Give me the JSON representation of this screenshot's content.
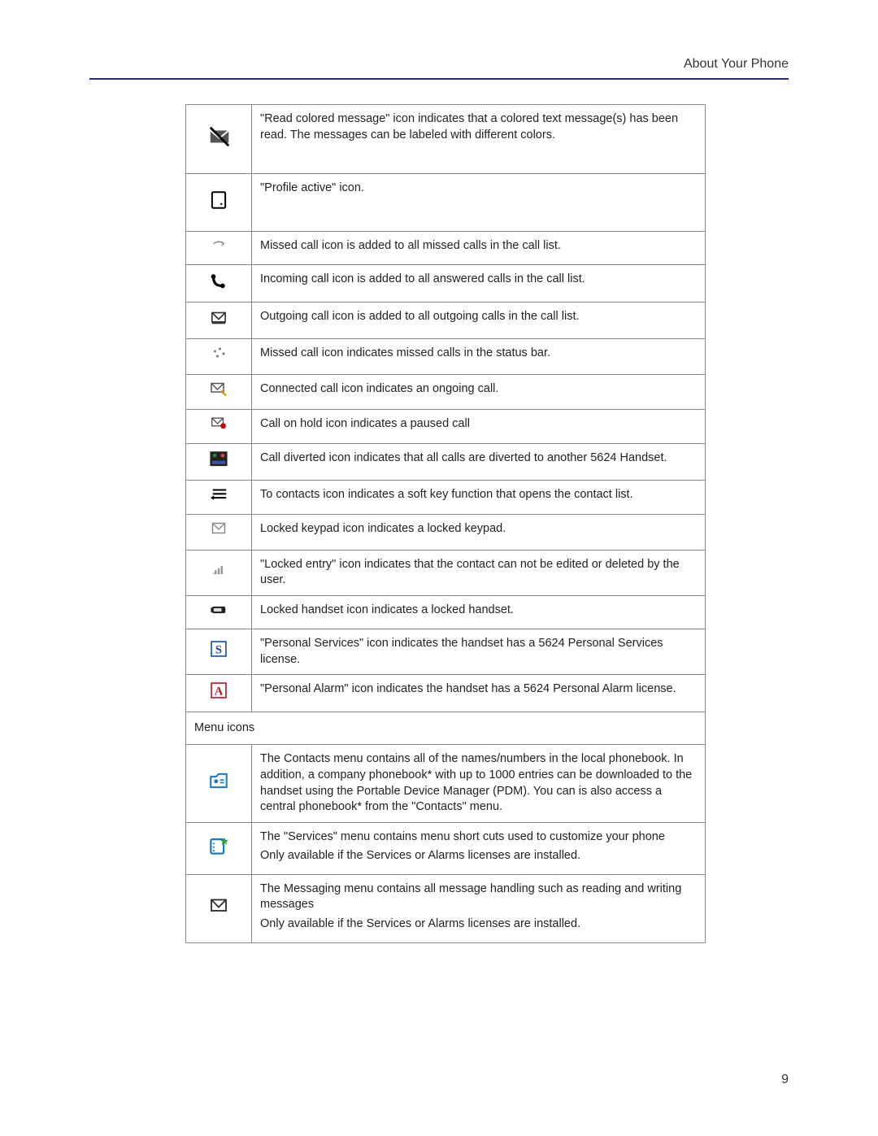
{
  "header_title": "About Your Phone",
  "page_number": "9",
  "section_header": "Menu  icons",
  "rows": [
    {
      "icon": "read-colored-message-icon",
      "desc": "\"Read colored message\" icon indicates that a colored text message(s) has been read. The messages can be labeled with different colors."
    },
    {
      "icon": "profile-active-icon",
      "desc": "\"Profile active\" icon."
    },
    {
      "icon": "missed-call-list-icon",
      "desc": "Missed call  icon is added to all missed calls in the call list."
    },
    {
      "icon": "incoming-call-icon",
      "desc": "Incoming call  icon is added to all answered calls in the call list."
    },
    {
      "icon": "outgoing-call-icon",
      "desc": "Outgoing call  icon is added to all outgoing calls in the call list."
    },
    {
      "icon": "missed-call-status-icon",
      "desc": "Missed call  icon indicates missed calls in the status bar."
    },
    {
      "icon": "connected-call-icon",
      "desc": "Connected call  icon indicates an ongoing call."
    },
    {
      "icon": "call-on-hold-icon",
      "desc": "Call on hold  icon indicates a paused call"
    },
    {
      "icon": "call-diverted-icon",
      "desc": "Call diverted  icon indicates that all calls are diverted to another 5624 Handset."
    },
    {
      "icon": "to-contacts-icon",
      "desc": "To contacts  icon indicates a soft key function that opens the contact list."
    },
    {
      "icon": "locked-keypad-icon",
      "desc": "Locked keypad   icon indicates a locked keypad."
    },
    {
      "icon": "locked-entry-icon",
      "desc": "\"Locked entry\" icon indicates that the contact can not be edited or deleted by the user."
    },
    {
      "icon": "locked-handset-icon",
      "desc": "Locked handset  icon indicates a locked handset."
    },
    {
      "icon": "personal-services-icon",
      "desc": "\"Personal Services\" icon indicates the handset has a 5624 Personal Services license."
    },
    {
      "icon": "personal-alarm-icon",
      "desc": "\"Personal Alarm\" icon indicates the handset has a 5624 Personal Alarm license."
    }
  ],
  "menu_rows": [
    {
      "icon": "contacts-menu-icon",
      "desc": "The  Contacts  menu contains all of the names/numbers in the local phonebook. In addition, a company phonebook* with up to 1000 entries can be downloaded to the handset using the Portable Device Manager (PDM). You can is also access a central phonebook* from the \"Contacts\" menu."
    },
    {
      "icon": "services-menu-icon",
      "desc": "The \"Services\" menu contains menu short cuts used to customize your phone",
      "desc2": "Only available if the Services or Alarms licenses are installed."
    },
    {
      "icon": "messaging-menu-icon",
      "desc": "The  Messaging  menu contains all message handling such as reading and writing messages",
      "desc2": "Only available if the Services or Alarms licenses are installed."
    }
  ]
}
